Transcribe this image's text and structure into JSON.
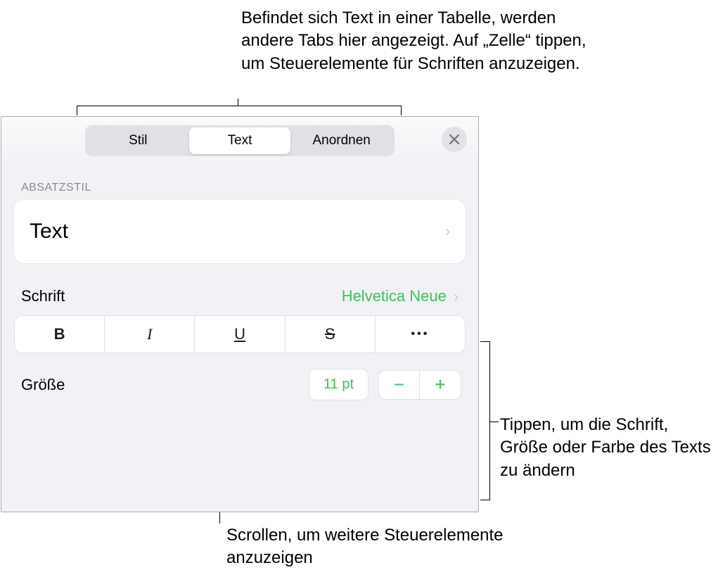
{
  "callouts": {
    "top": "Befindet sich Text in einer Tabelle, werden andere Tabs hier angezeigt. Auf „Zelle“ tippen, um Steuerelemente für Schriften anzuzeigen.",
    "right": "Tippen, um die Schrift, Größe oder Farbe des Texts zu ändern",
    "bottom": "Scrollen, um weitere Steuerelemente anzuzeigen"
  },
  "tabs": {
    "items": [
      "Stil",
      "Text",
      "Anordnen"
    ],
    "active": 1
  },
  "sections": {
    "paragraph_label": "Absatzstil",
    "paragraph_value": "Text",
    "font_label": "Schrift",
    "font_value": "Helvetica Neue",
    "size_label": "Größe",
    "size_value": "11 pt"
  },
  "fmt": {
    "bold": "B",
    "italic": "I",
    "underline": "U",
    "strike": "S",
    "more": "•••"
  },
  "stepper": {
    "minus": "−",
    "plus": "+"
  }
}
